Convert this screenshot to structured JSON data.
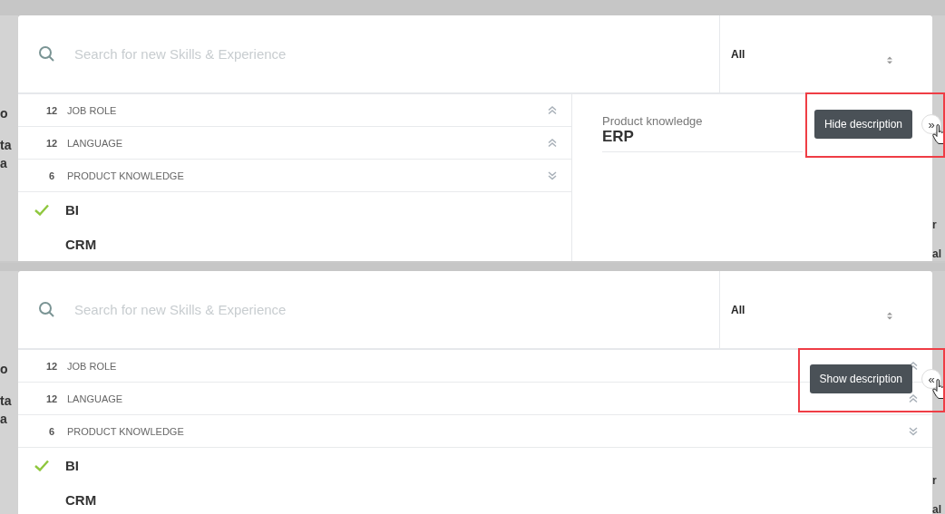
{
  "panels": [
    {
      "background_left": [
        "o",
        "ta",
        "a"
      ],
      "background_right": [
        "r",
        "al"
      ],
      "search": {
        "placeholder": "Search for new Skills & Experience"
      },
      "filter": {
        "value": "All"
      },
      "categories": [
        {
          "count": "12",
          "label": "JOB ROLE",
          "expanded": false
        },
        {
          "count": "12",
          "label": "LANGUAGE",
          "expanded": false
        },
        {
          "count": "6",
          "label": "PRODUCT KNOWLEDGE",
          "expanded": true
        }
      ],
      "items": [
        {
          "label": "BI",
          "checked": true
        },
        {
          "label": "CRM",
          "checked": false
        }
      ],
      "description_visible": true,
      "description": {
        "category": "Product knowledge",
        "title": "ERP"
      },
      "toggle": {
        "symbol": "»",
        "tooltip": "Hide description"
      },
      "highlighted": true
    },
    {
      "background_left": [
        "o",
        "ta",
        "a"
      ],
      "background_right": [
        "r",
        "al"
      ],
      "search": {
        "placeholder": "Search for new Skills & Experience"
      },
      "filter": {
        "value": "All"
      },
      "categories": [
        {
          "count": "12",
          "label": "JOB ROLE",
          "expanded": false
        },
        {
          "count": "12",
          "label": "LANGUAGE",
          "expanded": false
        },
        {
          "count": "6",
          "label": "PRODUCT KNOWLEDGE",
          "expanded": true
        }
      ],
      "items": [
        {
          "label": "BI",
          "checked": true
        },
        {
          "label": "CRM",
          "checked": false
        }
      ],
      "description_visible": false,
      "toggle": {
        "symbol": "«",
        "tooltip": "Show description"
      },
      "highlighted": true
    }
  ]
}
